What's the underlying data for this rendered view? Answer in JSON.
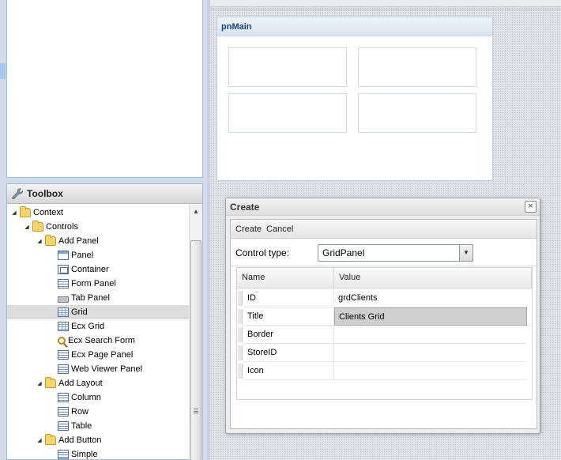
{
  "toolbox": {
    "title": "Toolbox",
    "tree": [
      {
        "label": "Context",
        "icon": "folder-icon",
        "depth": 0,
        "expanded": true
      },
      {
        "label": "Controls",
        "icon": "folder-icon",
        "depth": 1,
        "expanded": true
      },
      {
        "label": "Add Panel",
        "icon": "folder-icon",
        "depth": 2,
        "expanded": true
      },
      {
        "label": "Panel",
        "icon": "panel-icon",
        "depth": 3
      },
      {
        "label": "Container",
        "icon": "container-icon",
        "depth": 3
      },
      {
        "label": "Form Panel",
        "icon": "form-panel-icon",
        "depth": 3
      },
      {
        "label": "Tab Panel",
        "icon": "tab-panel-icon",
        "depth": 3
      },
      {
        "label": "Grid",
        "icon": "grid-icon",
        "depth": 3,
        "selected": true
      },
      {
        "label": "Ecx Grid",
        "icon": "grid-icon",
        "depth": 3
      },
      {
        "label": "Ecx Search Form",
        "icon": "search-icon",
        "depth": 3
      },
      {
        "label": "Ecx Page Panel",
        "icon": "form-panel-icon",
        "depth": 3
      },
      {
        "label": "Web Viewer Panel",
        "icon": "form-panel-icon",
        "depth": 3
      },
      {
        "label": "Add Layout",
        "icon": "folder-icon",
        "depth": 2,
        "expanded": true
      },
      {
        "label": "Column",
        "icon": "form-panel-icon",
        "depth": 3
      },
      {
        "label": "Row",
        "icon": "form-panel-icon",
        "depth": 3
      },
      {
        "label": "Table",
        "icon": "form-panel-icon",
        "depth": 3
      },
      {
        "label": "Add Button",
        "icon": "folder-icon",
        "depth": 2,
        "expanded": true
      },
      {
        "label": "Simple",
        "icon": "form-panel-icon",
        "depth": 3
      }
    ]
  },
  "design": {
    "panel_title": "pnMain"
  },
  "dialog": {
    "title": "Create",
    "close_label": "×",
    "toolbar": {
      "create_label": "Create",
      "cancel_label": "Cancel"
    },
    "control_type_label": "Control type:",
    "control_type_value": "GridPanel",
    "grid_headers": {
      "name": "Name",
      "value": "Value"
    },
    "rows": [
      {
        "name": "ID",
        "value": "grdClients"
      },
      {
        "name": "Title",
        "value": "Clients Grid",
        "active": true
      },
      {
        "name": "Border",
        "value": ""
      },
      {
        "name": "StoreID",
        "value": ""
      },
      {
        "name": "Icon",
        "value": ""
      }
    ]
  },
  "colors": {
    "panel_title": "#15428b",
    "selection": "#dcdcdc",
    "panel_border": "#99bbe8"
  }
}
